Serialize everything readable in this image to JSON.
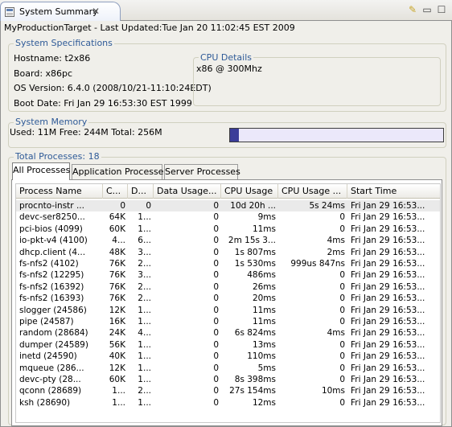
{
  "tab": {
    "title": "System Summary",
    "close": "✕"
  },
  "toolbar": {
    "clear_icon": "✎",
    "minimize": "▭",
    "maximize": "☐"
  },
  "target": {
    "line": "MyProductionTarget  - Last Updated:Tue Jan 20 11:02:45 EST 2009"
  },
  "specs": {
    "title": "System Specifications",
    "hostname": "Hostname: t2x86",
    "board": "Board: x86pc",
    "os_version": "OS Version: 6.4.0 (2008/10/21-11:10:24EDT)",
    "boot_date": "Boot Date: Fri Jan 29 16:53:30 EST 1999",
    "cpu_title": "CPU Details",
    "cpu_value": "x86 @ 300Mhz"
  },
  "memory": {
    "title": "System Memory",
    "summary": "Used: 11M  Free: 244M  Total: 256M",
    "used_fraction": 0.043
  },
  "processes": {
    "title": "Total Processes: 18",
    "tabs": [
      "All Processes",
      "Application Processes",
      "Server Processes"
    ],
    "columns": [
      "Process Name",
      "C...",
      "D...",
      "Data Usage...",
      "CPU Usage",
      "CPU Usage ...",
      "Start Time"
    ],
    "rows": [
      [
        "procnto-instr ...",
        "0",
        "0",
        "0",
        "10d 20h ...",
        "5s 24ms",
        "Fri Jan 29 16:53..."
      ],
      [
        "devc-ser8250...",
        "64K",
        "1...",
        "0",
        "9ms",
        "0",
        "Fri Jan 29 16:53..."
      ],
      [
        "pci-bios (4099)",
        "60K",
        "1...",
        "0",
        "11ms",
        "0",
        "Fri Jan 29 16:53..."
      ],
      [
        "io-pkt-v4 (4100)",
        "4...",
        "6...",
        "0",
        "2m 15s 3...",
        "4ms",
        "Fri Jan 29 16:53..."
      ],
      [
        "dhcp.client (4...",
        "48K",
        "3...",
        "0",
        "1s 807ms",
        "2ms",
        "Fri Jan 29 16:53..."
      ],
      [
        "fs-nfs2 (4102)",
        "76K",
        "2...",
        "0",
        "1s 530ms",
        "999us 847ns",
        "Fri Jan 29 16:53..."
      ],
      [
        "fs-nfs2 (12295)",
        "76K",
        "3...",
        "0",
        "486ms",
        "0",
        "Fri Jan 29 16:53..."
      ],
      [
        "fs-nfs2 (16392)",
        "76K",
        "2...",
        "0",
        "26ms",
        "0",
        "Fri Jan 29 16:53..."
      ],
      [
        "fs-nfs2 (16393)",
        "76K",
        "2...",
        "0",
        "20ms",
        "0",
        "Fri Jan 29 16:53..."
      ],
      [
        "slogger (24586)",
        "12K",
        "1...",
        "0",
        "11ms",
        "0",
        "Fri Jan 29 16:53..."
      ],
      [
        "pipe (24587)",
        "16K",
        "1...",
        "0",
        "11ms",
        "0",
        "Fri Jan 29 16:53..."
      ],
      [
        "random (28684)",
        "24K",
        "4...",
        "0",
        "6s 824ms",
        "4ms",
        "Fri Jan 29 16:53..."
      ],
      [
        "dumper (24589)",
        "56K",
        "1...",
        "0",
        "13ms",
        "0",
        "Fri Jan 29 16:53..."
      ],
      [
        "inetd (24590)",
        "40K",
        "1...",
        "0",
        "110ms",
        "0",
        "Fri Jan 29 16:53..."
      ],
      [
        "mqueue (286...",
        "12K",
        "1...",
        "0",
        "5ms",
        "0",
        "Fri Jan 29 16:53..."
      ],
      [
        "devc-pty (28...",
        "60K",
        "1...",
        "0",
        "8s 398ms",
        "0",
        "Fri Jan 29 16:53..."
      ],
      [
        "qconn (28689)",
        "1...",
        "2...",
        "0",
        "27s 154ms",
        "10ms",
        "Fri Jan 29 16:53..."
      ],
      [
        "ksh (28690)",
        "1...",
        "1...",
        "0",
        "12ms",
        "0",
        "Fri Jan 29 16:53..."
      ]
    ],
    "selected_row": 0
  }
}
